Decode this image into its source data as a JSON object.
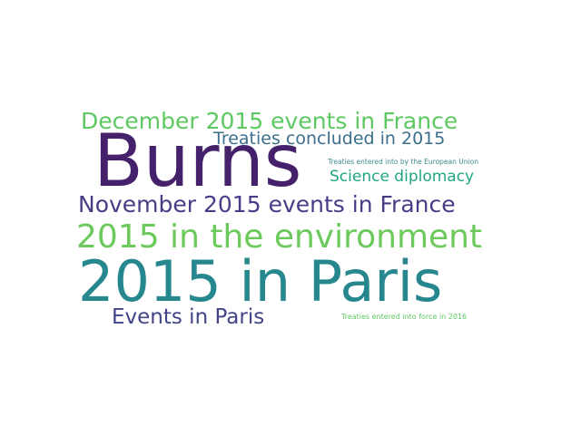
{
  "wordcloud": {
    "words": {
      "burns": "Burns",
      "paris": "2015 in Paris",
      "environment": "2015 in the environment",
      "november": "November 2015 events in France",
      "december": "December 2015 events in France",
      "events_paris": "Events in Paris",
      "treaties_2015": "Treaties concluded in 2015",
      "science": "Science diplomacy",
      "eu_treaties": "Treaties entered into by the European Union",
      "force_2016": "Treaties entered into force in 2016"
    },
    "colors": {
      "burns": "#46216b",
      "paris": "#26888e",
      "environment": "#6cc95c",
      "november": "#463d87",
      "december": "#5ec962",
      "events_paris": "#414487",
      "treaties_2015": "#3b6f8e",
      "science": "#21a685",
      "eu_treaties": "#3f8b8c",
      "force_2016": "#5cc863"
    },
    "background": "#ffffff"
  }
}
